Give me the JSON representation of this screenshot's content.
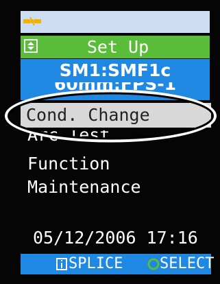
{
  "header": {
    "icon": "fiber-ends-icon",
    "color": "#ccdcf2"
  },
  "title": {
    "label": "Set Up",
    "icon": "scroll-arrows-icon",
    "color": "#5abd3a"
  },
  "fiber_setting": {
    "label": "SM1:SMF1c",
    "color": "#1f88e3"
  },
  "splice_setting": {
    "label": "60mm:FPS-1"
  },
  "menu": {
    "items": [
      {
        "label": "Cond. Change",
        "selected": true
      },
      {
        "label": "Arc Test"
      },
      {
        "label": "Function"
      },
      {
        "label": "Maintenance"
      }
    ]
  },
  "status": {
    "datetime": "05/12/2006 17:16"
  },
  "softkeys": {
    "left": {
      "label": "SPLICE",
      "icon": "info-icon"
    },
    "right": {
      "label": "SELECT",
      "icon": "circle-icon"
    }
  }
}
